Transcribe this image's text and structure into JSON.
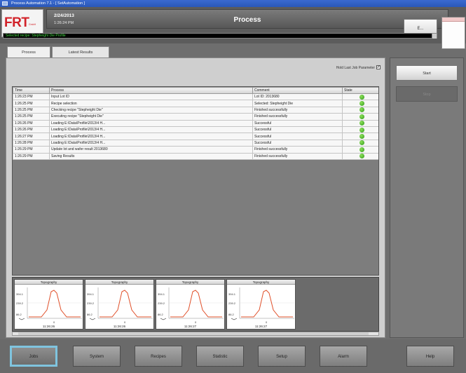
{
  "window": {
    "title": "Process Automation 7.1 - [ SetAutomation ]"
  },
  "header": {
    "logo_text": "FRT",
    "logo_sub": "GmbH",
    "date": "2/24/2013",
    "time": "1:26:24 PM",
    "page_title": "Process",
    "top_button_label": "E...",
    "status_text": "Selected recipe: Stepheight Die Profile"
  },
  "tabs": [
    {
      "label": "Process"
    },
    {
      "label": "Latest Results"
    }
  ],
  "options": {
    "hold_label": "Hold Last Job Parameter",
    "hold_checked": "✔"
  },
  "table": {
    "columns": [
      "Time",
      "Process",
      "Comment",
      "State"
    ],
    "rows": [
      {
        "time": "1:26:23 PM",
        "process": "Input Lot ID",
        "comment": "Lot ID: 2013680"
      },
      {
        "time": "1:26:25 PM",
        "process": "Recipe selection",
        "comment": "Selected: Stepheight Die"
      },
      {
        "time": "1:26:25 PM",
        "process": "Checking recipe \"Stepheight Die\"",
        "comment": "Finished successfully"
      },
      {
        "time": "1:26:25 PM",
        "process": "Executing recipe \"Stepheight Die\"",
        "comment": "Finished successfully"
      },
      {
        "time": "1:26:26 PM",
        "process": "Loading E:\\Data\\Profile\\2013\\4 H...",
        "comment": "Successful"
      },
      {
        "time": "1:26:26 PM",
        "process": "Loading E:\\Data\\Profile\\2013\\4 H...",
        "comment": "Successful"
      },
      {
        "time": "1:26:27 PM",
        "process": "Loading E:\\Data\\Profile\\2013\\4 H...",
        "comment": "Successful"
      },
      {
        "time": "1:26:28 PM",
        "process": "Loading E:\\Data\\Profile\\2013\\4 H...",
        "comment": "Successful"
      },
      {
        "time": "1:26:29 PM",
        "process": "Update lot and wafer result 2013680",
        "comment": "Finished successfully"
      },
      {
        "time": "1:26:29 PM",
        "process": "Saving Results",
        "comment": "Finished successfully"
      }
    ]
  },
  "thumbnails": [
    {
      "title": "Topography",
      "caption": "11:26:26",
      "y_top": "394.1",
      "y_mid": "239.2",
      "y_low": "86.2",
      "x_mid": "0"
    },
    {
      "title": "Topography",
      "caption": "11:26:26",
      "y_top": "394.1",
      "y_mid": "239.2",
      "y_low": "86.2",
      "x_mid": "0"
    },
    {
      "title": "Topography",
      "caption": "11:26:27",
      "y_top": "394.1",
      "y_mid": "239.2",
      "y_low": "86.2",
      "x_mid": "0"
    },
    {
      "title": "Topography",
      "caption": "11:26:27",
      "y_top": "394.1",
      "y_mid": "239.2",
      "y_low": "86.2",
      "x_mid": "0"
    }
  ],
  "side_panel": {
    "start_label": "Start",
    "stop_label": "Stop"
  },
  "bottom_nav": [
    {
      "label": "Jobs",
      "active": true
    },
    {
      "label": "System"
    },
    {
      "label": "Recipes"
    },
    {
      "label": "Statistic"
    },
    {
      "label": "Setup"
    },
    {
      "label": "Alarm"
    },
    {
      "label": "Help"
    }
  ],
  "colors": {
    "accent_active": "#7fc4df",
    "state_ok": "#3fae25",
    "profile_line": "#e0502a",
    "logo_red": "#d2232a"
  }
}
